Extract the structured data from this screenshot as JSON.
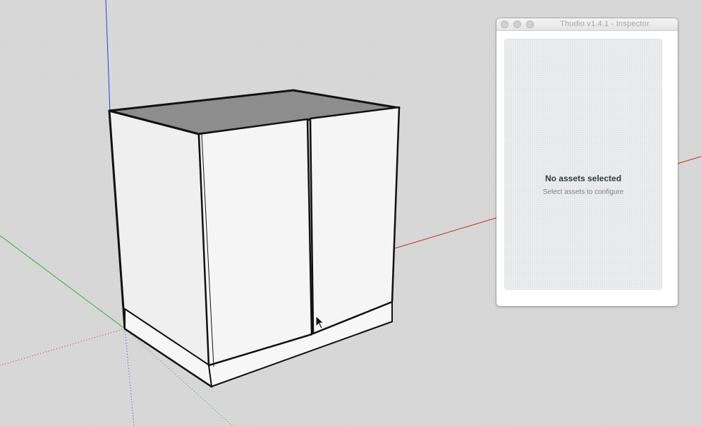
{
  "inspector": {
    "title": "Thudio v1.4.1 - Inspector",
    "empty_title": "No assets selected",
    "empty_subtitle": "Select assets to configure"
  },
  "colors": {
    "canvas_background": "#dadada",
    "axis_red": "#c62828",
    "axis_green": "#3aa93a",
    "axis_blue": "#2b3fd6",
    "cabinet_face": "#f3f3f3",
    "cabinet_top": "#8c8c8c"
  },
  "icons": {
    "cursor": "arrow-cursor-icon"
  }
}
